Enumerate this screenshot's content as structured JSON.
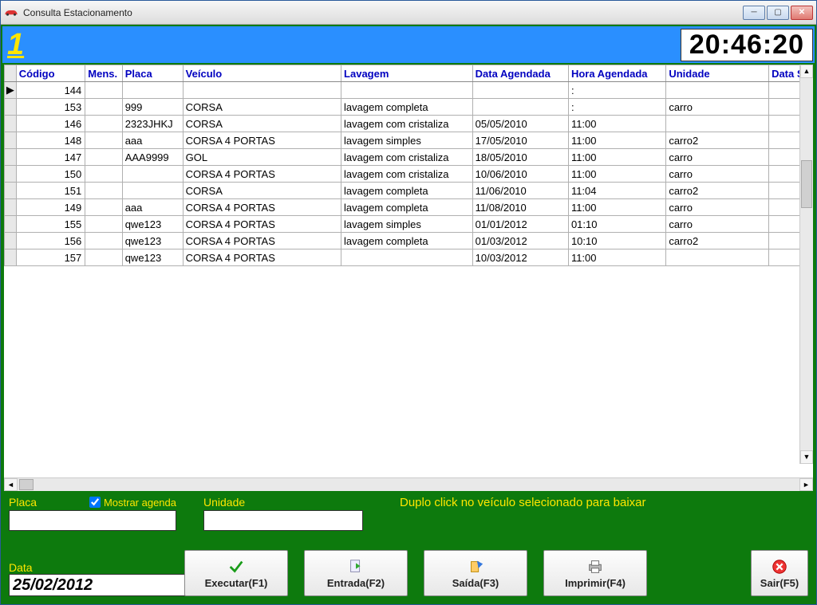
{
  "window": {
    "title": "Consulta Estacionamento"
  },
  "topbar": {
    "number": "1",
    "clock": "20:46:20"
  },
  "grid": {
    "headers": [
      "Código",
      "Mens.",
      "Placa",
      "Veículo",
      "Lavagem",
      "Data Agendada",
      "Hora Agendada",
      "Unidade",
      "Data S"
    ],
    "rows": [
      {
        "codigo": "144",
        "mens": "",
        "placa": "",
        "veiculo": "",
        "lavagem": "",
        "data": "",
        "hora": ":",
        "unidade": ""
      },
      {
        "codigo": "153",
        "mens": "",
        "placa": "999",
        "veiculo": "CORSA",
        "lavagem": "lavagem completa",
        "data": "",
        "hora": ":",
        "unidade": "carro"
      },
      {
        "codigo": "146",
        "mens": "",
        "placa": "2323JHKJ",
        "veiculo": "CORSA",
        "lavagem": "lavagem com cristaliza",
        "data": "05/05/2010",
        "hora": "11:00",
        "unidade": ""
      },
      {
        "codigo": "148",
        "mens": "",
        "placa": "aaa",
        "veiculo": "CORSA 4 PORTAS",
        "lavagem": "lavagem simples",
        "data": "17/05/2010",
        "hora": "11:00",
        "unidade": "carro2"
      },
      {
        "codigo": "147",
        "mens": "",
        "placa": "AAA9999",
        "veiculo": "GOL",
        "lavagem": "lavagem com cristaliza",
        "data": "18/05/2010",
        "hora": "11:00",
        "unidade": "carro"
      },
      {
        "codigo": "150",
        "mens": "",
        "placa": "",
        "veiculo": "CORSA 4 PORTAS",
        "lavagem": "lavagem com cristaliza",
        "data": "10/06/2010",
        "hora": "11:00",
        "unidade": "carro"
      },
      {
        "codigo": "151",
        "mens": "",
        "placa": "",
        "veiculo": "CORSA",
        "lavagem": "lavagem completa",
        "data": "11/06/2010",
        "hora": "11:04",
        "unidade": "carro2"
      },
      {
        "codigo": "149",
        "mens": "",
        "placa": "aaa",
        "veiculo": "CORSA 4 PORTAS",
        "lavagem": "lavagem completa",
        "data": "11/08/2010",
        "hora": "11:00",
        "unidade": "carro"
      },
      {
        "codigo": "155",
        "mens": "",
        "placa": "qwe123",
        "veiculo": "CORSA 4 PORTAS",
        "lavagem": "lavagem simples",
        "data": "01/01/2012",
        "hora": "01:10",
        "unidade": "carro"
      },
      {
        "codigo": "156",
        "mens": "",
        "placa": "qwe123",
        "veiculo": "CORSA 4 PORTAS",
        "lavagem": "lavagem completa",
        "data": "01/03/2012",
        "hora": "10:10",
        "unidade": "carro2"
      },
      {
        "codigo": "157",
        "mens": "",
        "placa": "qwe123",
        "veiculo": "CORSA 4 PORTAS",
        "lavagem": "",
        "data": "10/03/2012",
        "hora": "11:00",
        "unidade": ""
      }
    ]
  },
  "form": {
    "placa_label": "Placa",
    "placa_value": "",
    "show_agenda_label": "Mostrar agenda",
    "show_agenda_checked": true,
    "unidade_label": "Unidade",
    "unidade_value": "",
    "hint": "Duplo click no veículo selecionado para baixar",
    "data_label": "Data",
    "data_value": "25/02/2012"
  },
  "buttons": {
    "executar": "Executar(F1)",
    "entrada": "Entrada(F2)",
    "saida": "Saída(F3)",
    "imprimir": "Imprimir(F4)",
    "sair": "Sair(F5)"
  }
}
